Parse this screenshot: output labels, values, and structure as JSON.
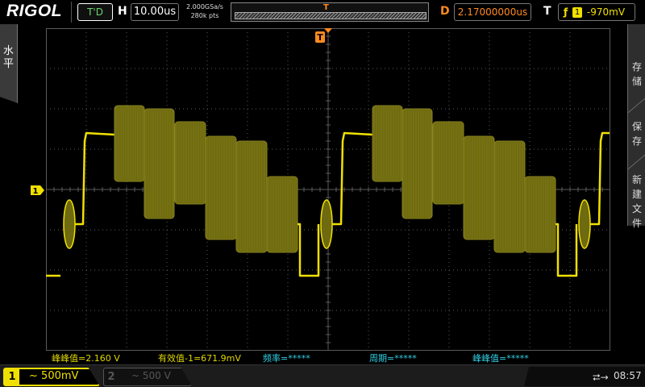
{
  "topbar": {
    "logo": "RIGOL",
    "trigger_status": "T'D",
    "horizontal_label": "H",
    "timebase": "10.00us",
    "sample_rate": "2.000GSa/s",
    "memory_depth": "280k pts",
    "delay_label": "D",
    "delay": "2.17000000us",
    "trigger_label": "T",
    "trigger_slope_icon": "rising-edge-icon",
    "trigger_channel": "1",
    "trigger_level": "-970mV"
  },
  "left_tab": {
    "label": "水平"
  },
  "right_menu": {
    "items": [
      "存储",
      "保存",
      "新建文件"
    ]
  },
  "markers": {
    "trigger_position": "T",
    "channel1_ground": "1"
  },
  "measurements": {
    "vpp_ch1": "峰峰值=2.160 V",
    "vrms_ch1": "有效值-1=671.9mV",
    "frequency": "频率=*****",
    "period": "周期=*****",
    "vpp_ch2": "峰峰值=*****"
  },
  "bottombar": {
    "ch1_number": "1",
    "ch1_coupling_icon": "ac-coupling-icon",
    "ch1_scale": "500mV",
    "ch2_number": "2",
    "ch2_scale": "500 V",
    "usb_icon": "usb-icon",
    "time": "08:57"
  },
  "colors": {
    "ch1": "#f0e000",
    "ch1_burst": "#6e6a10",
    "trigger_marker": "#ff8a1f",
    "measure_cyan": "#2fd0e6",
    "grid": "#5a5a5a"
  }
}
